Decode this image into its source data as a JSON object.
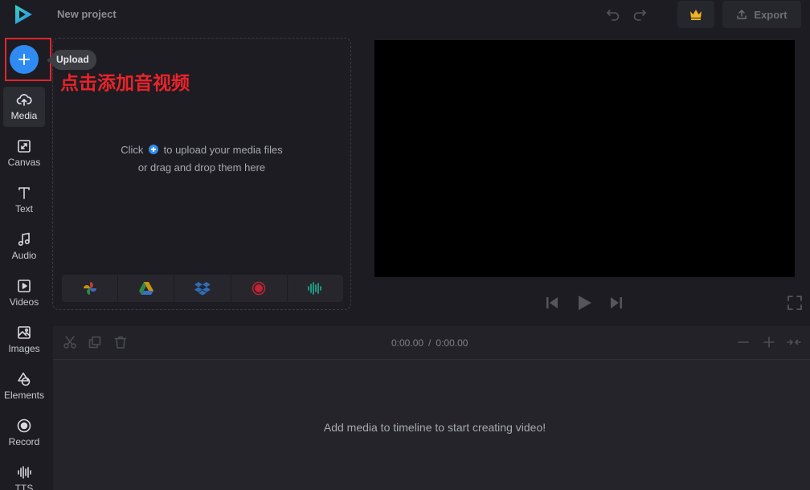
{
  "header": {
    "project_title": "New project",
    "export_label": "Export"
  },
  "sidebar": {
    "upload_tooltip": "Upload",
    "annotation": "点击添加音视频",
    "items": [
      {
        "label": "Media",
        "icon": "cloud-upload-icon",
        "active": true
      },
      {
        "label": "Canvas",
        "icon": "canvas-resize-icon"
      },
      {
        "label": "Text",
        "icon": "text-icon"
      },
      {
        "label": "Audio",
        "icon": "music-note-icon"
      },
      {
        "label": "Videos",
        "icon": "video-play-icon"
      },
      {
        "label": "Images",
        "icon": "image-icon"
      },
      {
        "label": "Elements",
        "icon": "shapes-icon"
      },
      {
        "label": "Record",
        "icon": "record-icon"
      },
      {
        "label": "TTS",
        "icon": "waveform-icon"
      }
    ]
  },
  "media_panel": {
    "hint_prefix": "Click",
    "hint_suffix": "to upload your media files",
    "hint_line2": "or drag and drop them here",
    "sources": [
      "google-photos-icon",
      "google-drive-icon",
      "dropbox-icon",
      "record-icon",
      "waveform-icon"
    ]
  },
  "timeline": {
    "current_time": "0:00.00",
    "separator": "/",
    "total_time": "0:00.00",
    "empty_message": "Add media to timeline to start creating video!"
  },
  "colors": {
    "accent": "#2f8bf2",
    "annotation": "#e8242a",
    "crown": "#f0b323",
    "background": "#1c1c22"
  }
}
